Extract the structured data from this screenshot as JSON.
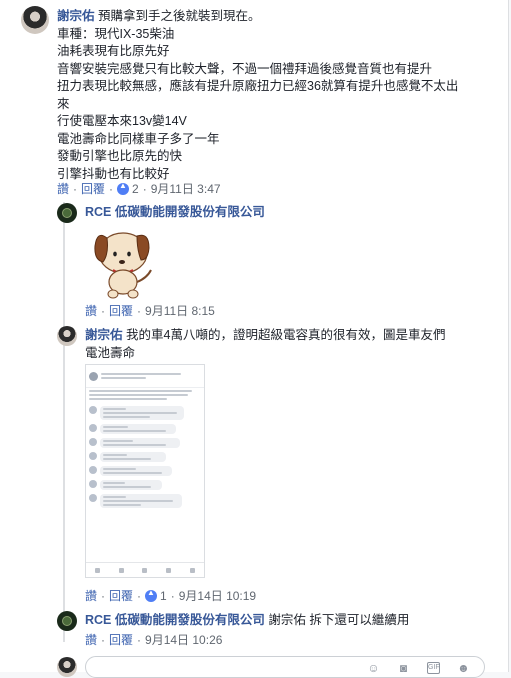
{
  "comment1": {
    "author": "謝宗佑",
    "lines": [
      "預購拿到手之後就裝到現在。",
      "車種：現代IX-35柴油",
      "油耗表現有比原先好",
      "音響安裝完感覺只有比較大聲，不過一個禮拜過後感覺音質也有提升",
      "扭力表現比較無感，應該有提升原廠扭力已經36就算有提升也感覺不太出",
      "來",
      "行使電壓本來13v變14V",
      "電池壽命比同樣車子多了一年",
      "發動引擎也比原先的快",
      "引擎抖動也有比較好"
    ],
    "like_label": "讚",
    "reply_label": "回覆",
    "reaction_count": "2",
    "timestamp": "9月11日 3:47"
  },
  "reply1": {
    "author": "RCE 低碳動能開發股份有限公司",
    "like_label": "讚",
    "reply_label": "回覆",
    "timestamp": "9月11日 8:15"
  },
  "reply2": {
    "author": "謝宗佑",
    "text_line1": "我的車4萬八噸的，證明超級電容真的很有效，圖是車友們",
    "text_line2": "電池壽命",
    "like_label": "讚",
    "reply_label": "回覆",
    "reaction_count": "1",
    "timestamp": "9月14日 10:19"
  },
  "reply3": {
    "author": "RCE 低碳動能開發股份有限公司",
    "text": "謝宗佑 拆下還可以繼續用",
    "like_label": "讚",
    "reply_label": "回覆",
    "timestamp": "9月14日 10:26"
  },
  "colors": {
    "link": "#385898",
    "action": "#4267b2",
    "like": "#4f7ef5"
  },
  "icons": [
    "emoji-icon",
    "camera-icon",
    "gif-icon",
    "sticker-icon"
  ]
}
